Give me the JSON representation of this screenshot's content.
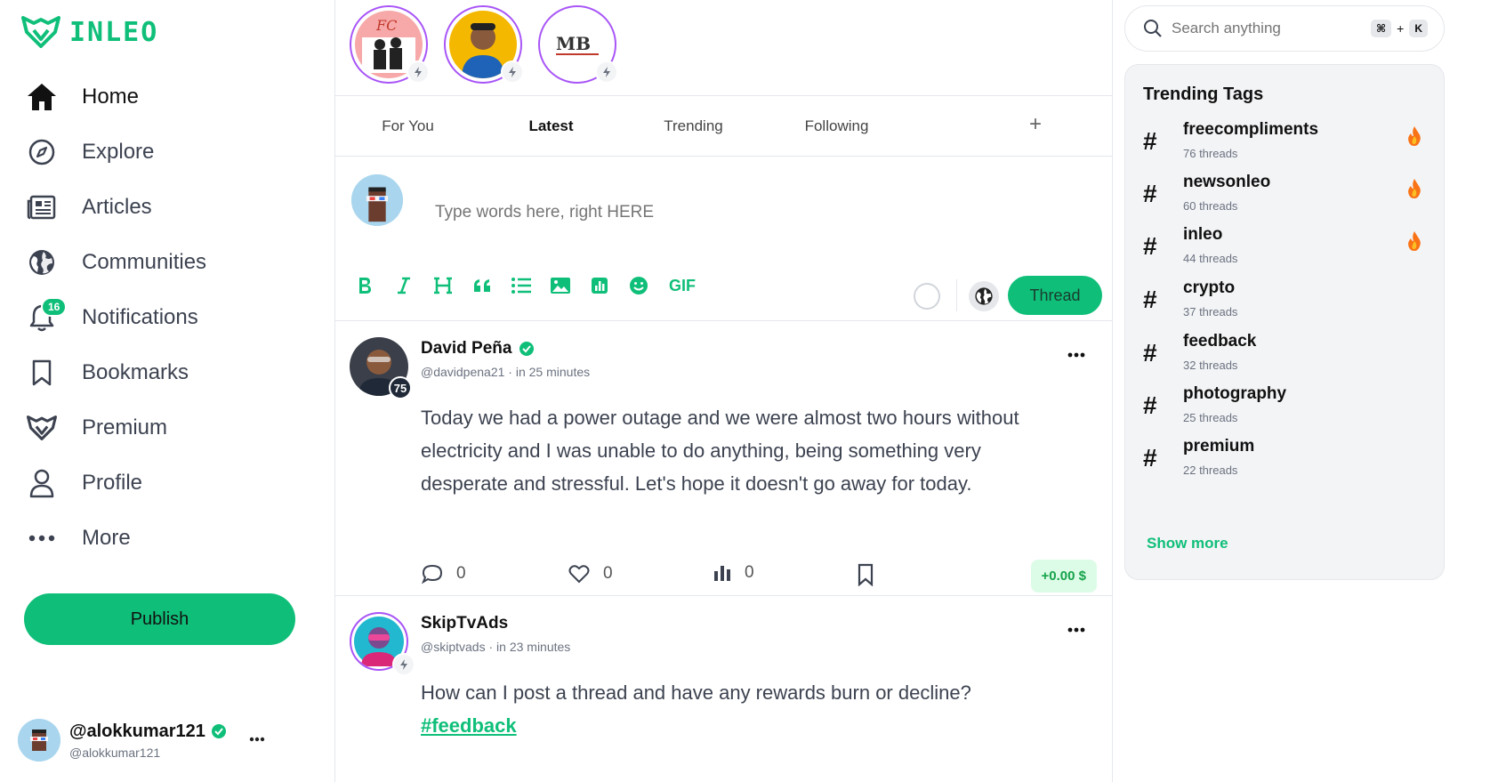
{
  "brand": {
    "name": "INLEO",
    "accent": "#0fbf79"
  },
  "nav": [
    {
      "key": "home",
      "label": "Home",
      "icon": "home-icon",
      "active": true
    },
    {
      "key": "explore",
      "label": "Explore",
      "icon": "compass-icon"
    },
    {
      "key": "articles",
      "label": "Articles",
      "icon": "newspaper-icon"
    },
    {
      "key": "communities",
      "label": "Communities",
      "icon": "globe-icon"
    },
    {
      "key": "notifications",
      "label": "Notifications",
      "icon": "bell-icon",
      "badge": "16"
    },
    {
      "key": "bookmarks",
      "label": "Bookmarks",
      "icon": "bookmark-icon"
    },
    {
      "key": "premium",
      "label": "Premium",
      "icon": "leo-icon"
    },
    {
      "key": "profile",
      "label": "Profile",
      "icon": "user-icon"
    },
    {
      "key": "more",
      "label": "More",
      "icon": "more-dots-icon"
    }
  ],
  "publish_label": "Publish",
  "account": {
    "name": "@alokkumar121",
    "handle": "@alokkumar121"
  },
  "stories": [
    {
      "label": "FC"
    },
    {
      "label": ""
    },
    {
      "label": "MB"
    }
  ],
  "tabs": [
    {
      "label": "For You"
    },
    {
      "label": "Latest",
      "active": true
    },
    {
      "label": "Trending"
    },
    {
      "label": "Following"
    }
  ],
  "tab_add": "+",
  "composer": {
    "placeholder": "Type words here, right HERE",
    "gif_label": "GIF",
    "submit_label": "Thread"
  },
  "posts": [
    {
      "name": "David Peña",
      "verified": true,
      "level": "75",
      "handle": "@davidpena21",
      "time": "in 25 minutes",
      "body": "Today we had a power outage and we were almost two hours without electricity and I was unable to do anything, being something very desperate and stressful. Let's hope it doesn't go away for today.",
      "comments": "0",
      "likes": "0",
      "views": "0",
      "earnings": "+0.00 $"
    },
    {
      "name": "SkipTvAds",
      "handle": "@skiptvads",
      "time": "in 23 minutes",
      "body": "How can I post a thread and have any rewards burn or decline?",
      "hashtag": "#feedback"
    }
  ],
  "search": {
    "placeholder": "Search anything",
    "kbd_cmd": "⌘",
    "kbd_plus": "+",
    "kbd_key": "K"
  },
  "trending": {
    "title": "Trending Tags",
    "tags": [
      {
        "name": "freecompliments",
        "count": "76 threads",
        "hot": true
      },
      {
        "name": "newsonleo",
        "count": "60 threads",
        "hot": true
      },
      {
        "name": "inleo",
        "count": "44 threads",
        "hot": true
      },
      {
        "name": "crypto",
        "count": "37 threads"
      },
      {
        "name": "feedback",
        "count": "32 threads"
      },
      {
        "name": "photography",
        "count": "25 threads"
      },
      {
        "name": "premium",
        "count": "22 threads"
      }
    ],
    "show_more": "Show more"
  }
}
